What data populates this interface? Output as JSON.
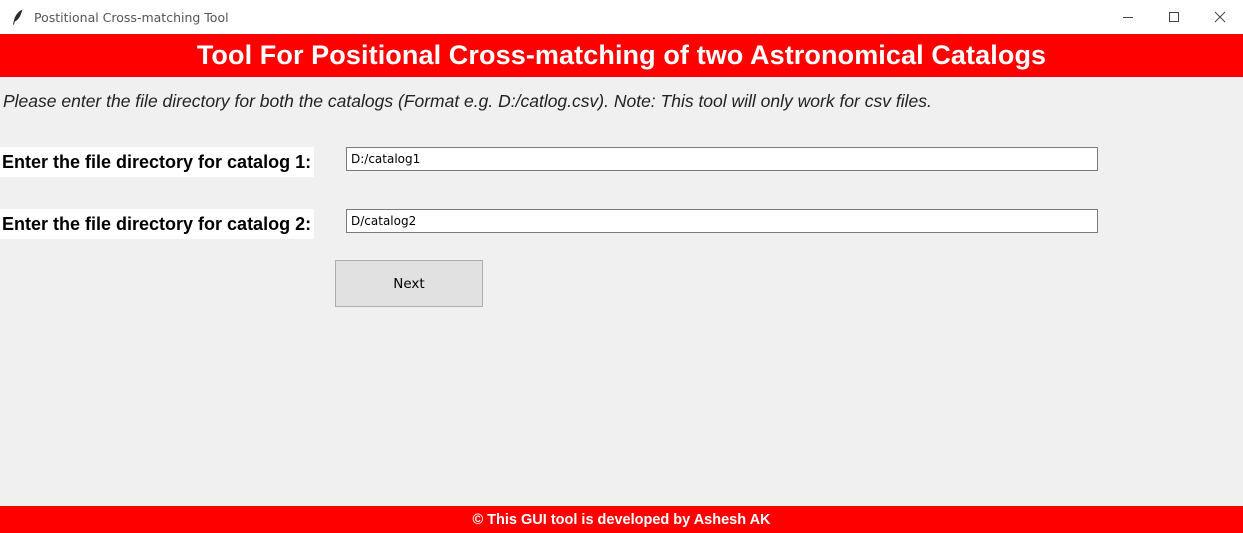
{
  "window": {
    "title": "Postitional Cross-matching Tool",
    "icon": "feather-icon",
    "controls": {
      "minimize": "—",
      "maximize": "☐",
      "close": "✕"
    }
  },
  "header": {
    "title": "Tool For Positional Cross-matching of two Astronomical Catalogs",
    "background": "#ff0000"
  },
  "instructions": "Please enter the file directory for both the catalogs (Format e.g. D:/catlog.csv). Note: This tool will only work for csv files.",
  "fields": [
    {
      "label": "Enter the file directory for catalog 1:",
      "value": "D:/catalog1"
    },
    {
      "label": "Enter the file directory for catalog 2:",
      "value": "D/catalog2"
    }
  ],
  "next_button": {
    "label": "Next"
  },
  "footer": {
    "text": "© This GUI tool is developed by Ashesh AK",
    "background": "#ff0000"
  }
}
